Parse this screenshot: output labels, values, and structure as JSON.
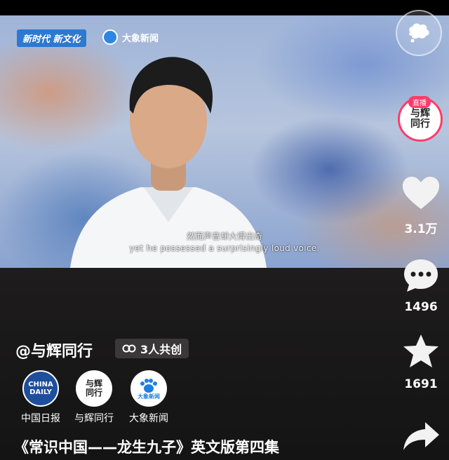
{
  "video": {
    "watermark_left": "新时代 新文化",
    "watermark_right": "大象新闻",
    "subtitle_cn": "然而声音却大得出奇",
    "subtitle_en": "yet he possessed a surprisingly loud voice."
  },
  "rail": {
    "avatar_badge": "直播",
    "avatar_name": "与辉同行",
    "likes": "3.1万",
    "comments": "1496",
    "favorites": "1691"
  },
  "author": {
    "handle": "@与辉同行",
    "collab_label": "3人共创"
  },
  "creators": [
    {
      "label": "中国日报",
      "logo_text": "CHINA DAILY"
    },
    {
      "label": "与辉同行",
      "logo_text": "与辉同行"
    },
    {
      "label": "大象新闻",
      "logo_text": "大象新闻"
    }
  ],
  "caption": "《常识中国——龙生九子》英文版第四集",
  "colors": {
    "live_pink": "#ff3b6b",
    "china_daily_blue": "#1f4f9c",
    "dxnews_blue": "#1e7fe0"
  }
}
